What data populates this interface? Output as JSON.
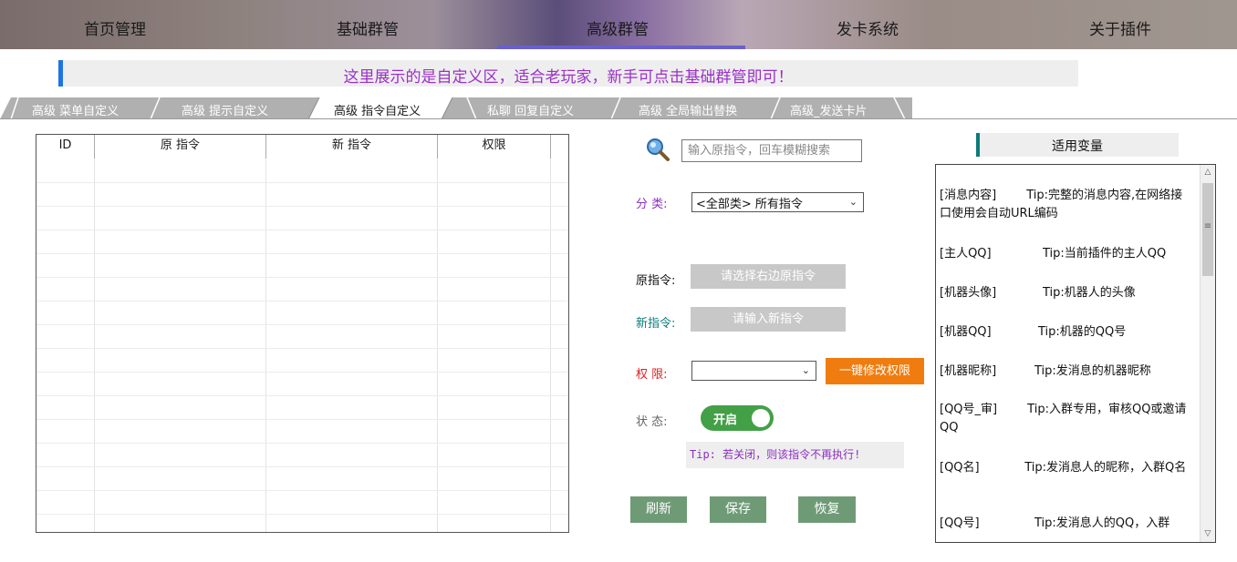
{
  "nav": {
    "items": [
      "首页管理",
      "基础群管",
      "高级群管",
      "发卡系统",
      "关于插件"
    ],
    "active_index": 2
  },
  "banner": {
    "text": "这里展示的是自定义区，适合老玩家，新手可点击基础群管即可！"
  },
  "tabs": {
    "items": [
      "高级 菜单自定义",
      "高级 提示自定义",
      "高级 指令自定义",
      "私聊 回复自定义",
      "高级 全局输出替换",
      "高级_发送卡片"
    ],
    "active_index": 2
  },
  "table": {
    "columns": [
      "ID",
      "原 指令",
      "新 指令",
      "权限"
    ],
    "rows": []
  },
  "search": {
    "placeholder": "输入原指令，回车模糊搜索",
    "icon": "magnifier-icon"
  },
  "form": {
    "category_label": "分 类:",
    "category_value": "<全部类> 所有指令",
    "orig_label": "原指令:",
    "orig_value": "请选择右边原指令",
    "new_label": "新指令:",
    "new_value": "请输入新指令",
    "perm_label": "权 限:",
    "perm_value": "",
    "perm_button": "一键修改权限",
    "status_label": "状 态:",
    "status_toggle": "开启",
    "status_on": true,
    "tip": "Tip: 若关闭，则该指令不再执行!"
  },
  "actions": {
    "refresh": "刷新",
    "save": "保存",
    "restore": "恢复"
  },
  "variables": {
    "title": "适用变量",
    "items": [
      {
        "key": "[消息内容]",
        "desc": "Tip:完整的消息内容,在网络接口使用会自动URL编码"
      },
      {
        "key": "[主人QQ]",
        "desc": "Tip:当前插件的主人QQ"
      },
      {
        "key": "[机器头像]",
        "desc": "Tip:机器人的头像"
      },
      {
        "key": "[机器QQ]",
        "desc": "Tip:机器的QQ号"
      },
      {
        "key": "[机器昵称]",
        "desc": "Tip:发消息的机器昵称"
      },
      {
        "key": "[QQ号_审]",
        "desc": "Tip:入群专用，审核QQ或邀请QQ"
      },
      {
        "key": "[QQ名]",
        "desc": "Tip:发消息人的昵称，入群Q名"
      },
      {
        "key": "[QQ号]",
        "desc": "Tip:发消息人的QQ，入群"
      }
    ]
  },
  "colors": {
    "banner_text": "#9b30c8",
    "accent_blue": "#1e73e8",
    "category_label": "#8c2fc0",
    "new_label": "#0b7a7a",
    "perm_label": "#e02020",
    "toggle_on": "#43a047",
    "orange_button": "#f07c0f",
    "green_button": "#6f9a76"
  }
}
